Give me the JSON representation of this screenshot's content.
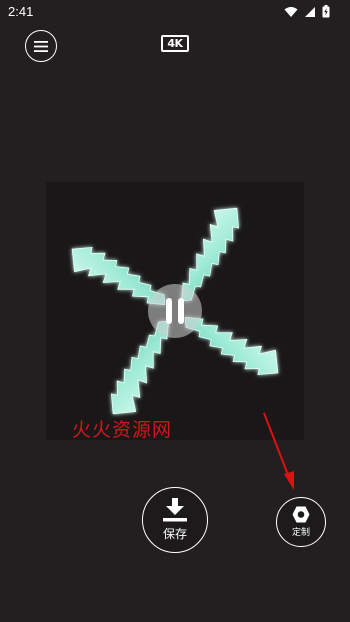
{
  "status_bar": {
    "time": "2:41",
    "icons": [
      "wifi-icon",
      "signal-icon",
      "battery-charging-icon"
    ]
  },
  "header": {
    "menu_icon": "menu-icon",
    "quality_badge": "4K"
  },
  "preview": {
    "playback_icon": "pause-icon",
    "watermark": "火火资源网"
  },
  "actions": {
    "save_label": "保存",
    "save_icon": "download-icon",
    "customize_label": "定制",
    "customize_icon": "hex-nut-icon"
  },
  "colors": {
    "background": "#231f20",
    "accent_mint": "#aef3e1",
    "watermark": "#d01818",
    "arrow": "#e01010"
  }
}
